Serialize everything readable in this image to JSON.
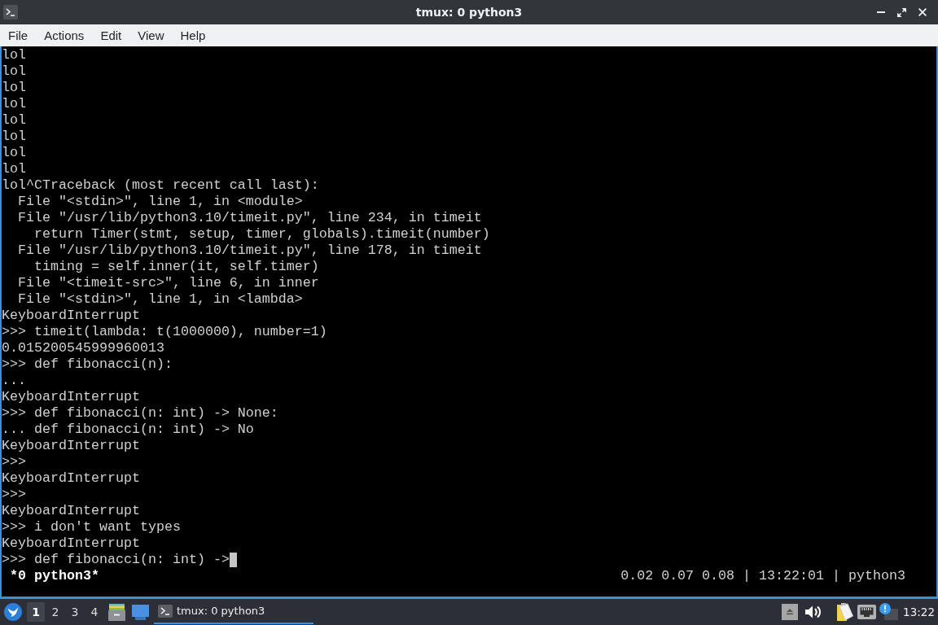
{
  "window": {
    "title": "tmux: 0 python3"
  },
  "menu_bar": [
    "File",
    "Actions",
    "Edit",
    "View",
    "Help"
  ],
  "terminal": {
    "lines": [
      "lol",
      "lol",
      "lol",
      "lol",
      "lol",
      "lol",
      "lol",
      "lol",
      "lol^CTraceback (most recent call last):",
      "  File \"<stdin>\", line 1, in <module>",
      "  File \"/usr/lib/python3.10/timeit.py\", line 234, in timeit",
      "    return Timer(stmt, setup, timer, globals).timeit(number)",
      "  File \"/usr/lib/python3.10/timeit.py\", line 178, in timeit",
      "    timing = self.inner(it, self.timer)",
      "  File \"<timeit-src>\", line 6, in inner",
      "  File \"<stdin>\", line 1, in <lambda>",
      "KeyboardInterrupt",
      ">>> timeit(lambda: t(1000000), number=1)",
      "0.015200545999960013",
      ">>> def fibonacci(n):",
      "...",
      "KeyboardInterrupt",
      ">>> def fibonacci(n: int) -> None:",
      "... def fibonacci(n: int) -> No",
      "KeyboardInterrupt",
      ">>>",
      "KeyboardInterrupt",
      ">>>",
      "KeyboardInterrupt",
      ">>> i don't want types",
      "KeyboardInterrupt",
      ">>> def fibonacci(n: int) ->"
    ]
  },
  "tmux_status": {
    "left": "*0 python3*",
    "right": "0.02 0.07 0.08 | 13:22:01 | python3"
  },
  "taskbar": {
    "workspaces": [
      {
        "label": "1",
        "selected": true
      },
      {
        "label": "2",
        "selected": false
      },
      {
        "label": "3",
        "selected": false
      },
      {
        "label": "4",
        "selected": false
      }
    ],
    "tasks": [
      {
        "label": "tmux: 0 python3",
        "selected": true
      }
    ],
    "clock": "13:22"
  }
}
